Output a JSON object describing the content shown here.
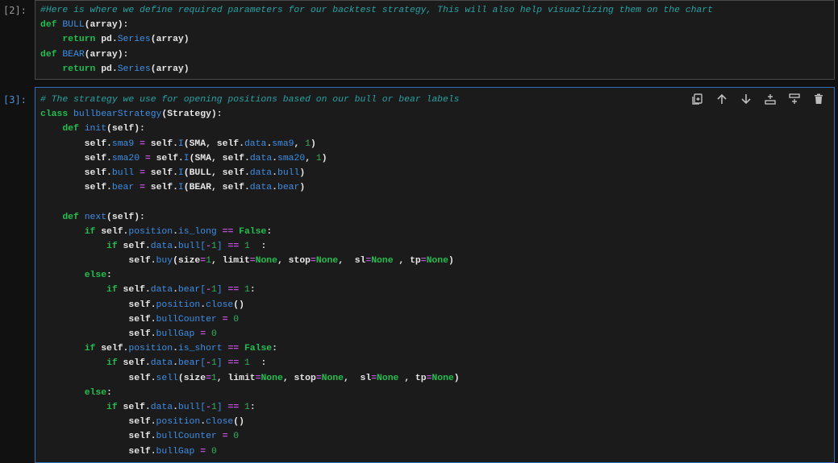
{
  "cells": [
    {
      "prompt": "[2]:",
      "active": false,
      "lines": [
        [
          {
            "t": "comment",
            "v": "#Here is where we define required parameters for our backtest strategy, This will also help visuazlizing them on the chart"
          }
        ],
        [
          {
            "t": "kw",
            "v": "def "
          },
          {
            "t": "def",
            "v": "BULL"
          },
          {
            "t": "plain",
            "v": "(array):"
          }
        ],
        [
          {
            "t": "plain",
            "v": "    "
          },
          {
            "t": "kw",
            "v": "return "
          },
          {
            "t": "plain",
            "v": "pd."
          },
          {
            "t": "attr",
            "v": "Series"
          },
          {
            "t": "plain",
            "v": "(array)"
          }
        ],
        [
          {
            "t": "kw",
            "v": "def "
          },
          {
            "t": "def",
            "v": "BEAR"
          },
          {
            "t": "plain",
            "v": "(array):"
          }
        ],
        [
          {
            "t": "plain",
            "v": "    "
          },
          {
            "t": "kw",
            "v": "return "
          },
          {
            "t": "plain",
            "v": "pd."
          },
          {
            "t": "attr",
            "v": "Series"
          },
          {
            "t": "plain",
            "v": "(array)"
          }
        ]
      ]
    },
    {
      "prompt": "[3]:",
      "active": true,
      "lines": [
        [
          {
            "t": "comment",
            "v": "# The strategy we use for opening positions based on our bull or bear labels"
          }
        ],
        [
          {
            "t": "kw",
            "v": "class "
          },
          {
            "t": "def",
            "v": "bullbearStrategy"
          },
          {
            "t": "plain",
            "v": "(Strategy):"
          }
        ],
        [
          {
            "t": "plain",
            "v": "    "
          },
          {
            "t": "kw",
            "v": "def "
          },
          {
            "t": "def",
            "v": "init"
          },
          {
            "t": "plain",
            "v": "(self):"
          }
        ],
        [
          {
            "t": "plain",
            "v": "        self."
          },
          {
            "t": "attr",
            "v": "sma9"
          },
          {
            "t": "plain",
            "v": " "
          },
          {
            "t": "op",
            "v": "="
          },
          {
            "t": "plain",
            "v": " self."
          },
          {
            "t": "attr",
            "v": "I"
          },
          {
            "t": "plain",
            "v": "(SMA, self."
          },
          {
            "t": "attr",
            "v": "data"
          },
          {
            "t": "plain",
            "v": "."
          },
          {
            "t": "attr",
            "v": "sma9"
          },
          {
            "t": "plain",
            "v": ", "
          },
          {
            "t": "num",
            "v": "1"
          },
          {
            "t": "plain",
            "v": ")"
          }
        ],
        [
          {
            "t": "plain",
            "v": "        self."
          },
          {
            "t": "attr",
            "v": "sma20"
          },
          {
            "t": "plain",
            "v": " "
          },
          {
            "t": "op",
            "v": "="
          },
          {
            "t": "plain",
            "v": " self."
          },
          {
            "t": "attr",
            "v": "I"
          },
          {
            "t": "plain",
            "v": "(SMA, self."
          },
          {
            "t": "attr",
            "v": "data"
          },
          {
            "t": "plain",
            "v": "."
          },
          {
            "t": "attr",
            "v": "sma20"
          },
          {
            "t": "plain",
            "v": ", "
          },
          {
            "t": "num",
            "v": "1"
          },
          {
            "t": "plain",
            "v": ")"
          }
        ],
        [
          {
            "t": "plain",
            "v": "        self."
          },
          {
            "t": "attr",
            "v": "bull"
          },
          {
            "t": "plain",
            "v": " "
          },
          {
            "t": "op",
            "v": "="
          },
          {
            "t": "plain",
            "v": " self."
          },
          {
            "t": "attr",
            "v": "I"
          },
          {
            "t": "plain",
            "v": "(BULL, self."
          },
          {
            "t": "attr",
            "v": "data"
          },
          {
            "t": "plain",
            "v": "."
          },
          {
            "t": "attr",
            "v": "bull"
          },
          {
            "t": "plain",
            "v": ")"
          }
        ],
        [
          {
            "t": "plain",
            "v": "        self."
          },
          {
            "t": "attr",
            "v": "bear"
          },
          {
            "t": "plain",
            "v": " "
          },
          {
            "t": "op",
            "v": "="
          },
          {
            "t": "plain",
            "v": " self."
          },
          {
            "t": "attr",
            "v": "I"
          },
          {
            "t": "plain",
            "v": "(BEAR, self."
          },
          {
            "t": "attr",
            "v": "data"
          },
          {
            "t": "plain",
            "v": "."
          },
          {
            "t": "attr",
            "v": "bear"
          },
          {
            "t": "plain",
            "v": ")"
          }
        ],
        [
          {
            "t": "plain",
            "v": ""
          }
        ],
        [
          {
            "t": "plain",
            "v": "    "
          },
          {
            "t": "kw",
            "v": "def "
          },
          {
            "t": "def",
            "v": "next"
          },
          {
            "t": "plain",
            "v": "(self):"
          }
        ],
        [
          {
            "t": "plain",
            "v": "        "
          },
          {
            "t": "kw",
            "v": "if "
          },
          {
            "t": "plain",
            "v": "self."
          },
          {
            "t": "attr",
            "v": "position"
          },
          {
            "t": "plain",
            "v": "."
          },
          {
            "t": "attr",
            "v": "is_long"
          },
          {
            "t": "plain",
            "v": " "
          },
          {
            "t": "op",
            "v": "=="
          },
          {
            "t": "plain",
            "v": " "
          },
          {
            "t": "kw",
            "v": "False"
          },
          {
            "t": "plain",
            "v": ":"
          }
        ],
        [
          {
            "t": "plain",
            "v": "            "
          },
          {
            "t": "kw",
            "v": "if "
          },
          {
            "t": "plain",
            "v": "self."
          },
          {
            "t": "attr",
            "v": "data"
          },
          {
            "t": "plain",
            "v": "."
          },
          {
            "t": "attr",
            "v": "bull"
          },
          {
            "t": "attr",
            "v": "["
          },
          {
            "t": "op",
            "v": "-"
          },
          {
            "t": "num",
            "v": "1"
          },
          {
            "t": "attr",
            "v": "]"
          },
          {
            "t": "plain",
            "v": " "
          },
          {
            "t": "op",
            "v": "=="
          },
          {
            "t": "plain",
            "v": " "
          },
          {
            "t": "num",
            "v": "1"
          },
          {
            "t": "plain",
            "v": "  :"
          }
        ],
        [
          {
            "t": "plain",
            "v": "                self."
          },
          {
            "t": "attr",
            "v": "buy"
          },
          {
            "t": "plain",
            "v": "(size"
          },
          {
            "t": "op",
            "v": "="
          },
          {
            "t": "num",
            "v": "1"
          },
          {
            "t": "plain",
            "v": ", limit"
          },
          {
            "t": "op",
            "v": "="
          },
          {
            "t": "kw",
            "v": "None"
          },
          {
            "t": "plain",
            "v": ", stop"
          },
          {
            "t": "op",
            "v": "="
          },
          {
            "t": "kw",
            "v": "None"
          },
          {
            "t": "plain",
            "v": ",  sl"
          },
          {
            "t": "op",
            "v": "="
          },
          {
            "t": "kw",
            "v": "None"
          },
          {
            "t": "plain",
            "v": " , tp"
          },
          {
            "t": "op",
            "v": "="
          },
          {
            "t": "kw",
            "v": "None"
          },
          {
            "t": "plain",
            "v": ")"
          }
        ],
        [
          {
            "t": "plain",
            "v": "        "
          },
          {
            "t": "kw",
            "v": "else"
          },
          {
            "t": "plain",
            "v": ":"
          }
        ],
        [
          {
            "t": "plain",
            "v": "            "
          },
          {
            "t": "kw",
            "v": "if "
          },
          {
            "t": "plain",
            "v": "self."
          },
          {
            "t": "attr",
            "v": "data"
          },
          {
            "t": "plain",
            "v": "."
          },
          {
            "t": "attr",
            "v": "bear"
          },
          {
            "t": "attr",
            "v": "["
          },
          {
            "t": "op",
            "v": "-"
          },
          {
            "t": "num",
            "v": "1"
          },
          {
            "t": "attr",
            "v": "]"
          },
          {
            "t": "plain",
            "v": " "
          },
          {
            "t": "op",
            "v": "=="
          },
          {
            "t": "plain",
            "v": " "
          },
          {
            "t": "num",
            "v": "1"
          },
          {
            "t": "plain",
            "v": ":"
          }
        ],
        [
          {
            "t": "plain",
            "v": "                self."
          },
          {
            "t": "attr",
            "v": "position"
          },
          {
            "t": "plain",
            "v": "."
          },
          {
            "t": "attr",
            "v": "close"
          },
          {
            "t": "plain",
            "v": "()"
          }
        ],
        [
          {
            "t": "plain",
            "v": "                self."
          },
          {
            "t": "attr",
            "v": "bullCounter"
          },
          {
            "t": "plain",
            "v": " "
          },
          {
            "t": "op",
            "v": "="
          },
          {
            "t": "plain",
            "v": " "
          },
          {
            "t": "num",
            "v": "0"
          }
        ],
        [
          {
            "t": "plain",
            "v": "                self."
          },
          {
            "t": "attr",
            "v": "bullGap"
          },
          {
            "t": "plain",
            "v": " "
          },
          {
            "t": "op",
            "v": "="
          },
          {
            "t": "plain",
            "v": " "
          },
          {
            "t": "num",
            "v": "0"
          }
        ],
        [
          {
            "t": "plain",
            "v": "        "
          },
          {
            "t": "kw",
            "v": "if "
          },
          {
            "t": "plain",
            "v": "self."
          },
          {
            "t": "attr",
            "v": "position"
          },
          {
            "t": "plain",
            "v": "."
          },
          {
            "t": "attr",
            "v": "is_short"
          },
          {
            "t": "plain",
            "v": " "
          },
          {
            "t": "op",
            "v": "=="
          },
          {
            "t": "plain",
            "v": " "
          },
          {
            "t": "kw",
            "v": "False"
          },
          {
            "t": "plain",
            "v": ":"
          }
        ],
        [
          {
            "t": "plain",
            "v": "            "
          },
          {
            "t": "kw",
            "v": "if "
          },
          {
            "t": "plain",
            "v": "self."
          },
          {
            "t": "attr",
            "v": "data"
          },
          {
            "t": "plain",
            "v": "."
          },
          {
            "t": "attr",
            "v": "bear"
          },
          {
            "t": "attr",
            "v": "["
          },
          {
            "t": "op",
            "v": "-"
          },
          {
            "t": "num",
            "v": "1"
          },
          {
            "t": "attr",
            "v": "]"
          },
          {
            "t": "plain",
            "v": " "
          },
          {
            "t": "op",
            "v": "=="
          },
          {
            "t": "plain",
            "v": " "
          },
          {
            "t": "num",
            "v": "1"
          },
          {
            "t": "plain",
            "v": "  :"
          }
        ],
        [
          {
            "t": "plain",
            "v": "                self."
          },
          {
            "t": "attr",
            "v": "sell"
          },
          {
            "t": "plain",
            "v": "(size"
          },
          {
            "t": "op",
            "v": "="
          },
          {
            "t": "num",
            "v": "1"
          },
          {
            "t": "plain",
            "v": ", limit"
          },
          {
            "t": "op",
            "v": "="
          },
          {
            "t": "kw",
            "v": "None"
          },
          {
            "t": "plain",
            "v": ", stop"
          },
          {
            "t": "op",
            "v": "="
          },
          {
            "t": "kw",
            "v": "None"
          },
          {
            "t": "plain",
            "v": ",  sl"
          },
          {
            "t": "op",
            "v": "="
          },
          {
            "t": "kw",
            "v": "None"
          },
          {
            "t": "plain",
            "v": " , tp"
          },
          {
            "t": "op",
            "v": "="
          },
          {
            "t": "kw",
            "v": "None"
          },
          {
            "t": "plain",
            "v": ")"
          }
        ],
        [
          {
            "t": "plain",
            "v": "        "
          },
          {
            "t": "kw",
            "v": "else"
          },
          {
            "t": "plain",
            "v": ":"
          }
        ],
        [
          {
            "t": "plain",
            "v": "            "
          },
          {
            "t": "kw",
            "v": "if "
          },
          {
            "t": "plain",
            "v": "self."
          },
          {
            "t": "attr",
            "v": "data"
          },
          {
            "t": "plain",
            "v": "."
          },
          {
            "t": "attr",
            "v": "bull"
          },
          {
            "t": "attr",
            "v": "["
          },
          {
            "t": "op",
            "v": "-"
          },
          {
            "t": "num",
            "v": "1"
          },
          {
            "t": "attr",
            "v": "]"
          },
          {
            "t": "plain",
            "v": " "
          },
          {
            "t": "op",
            "v": "=="
          },
          {
            "t": "plain",
            "v": " "
          },
          {
            "t": "num",
            "v": "1"
          },
          {
            "t": "plain",
            "v": ":"
          }
        ],
        [
          {
            "t": "plain",
            "v": "                self."
          },
          {
            "t": "attr",
            "v": "position"
          },
          {
            "t": "plain",
            "v": "."
          },
          {
            "t": "attr",
            "v": "close"
          },
          {
            "t": "plain",
            "v": "()"
          }
        ],
        [
          {
            "t": "plain",
            "v": "                self."
          },
          {
            "t": "attr",
            "v": "bullCounter"
          },
          {
            "t": "plain",
            "v": " "
          },
          {
            "t": "op",
            "v": "="
          },
          {
            "t": "plain",
            "v": " "
          },
          {
            "t": "num",
            "v": "0"
          }
        ],
        [
          {
            "t": "plain",
            "v": "                self."
          },
          {
            "t": "attr",
            "v": "bullGap"
          },
          {
            "t": "plain",
            "v": " "
          },
          {
            "t": "op",
            "v": "="
          },
          {
            "t": "plain",
            "v": " "
          },
          {
            "t": "num",
            "v": "0"
          }
        ]
      ]
    }
  ],
  "toolbar": {
    "buttons": [
      {
        "icon": "duplicate-icon",
        "name": "duplicate-cell-button"
      },
      {
        "icon": "arrow-up-icon",
        "name": "move-up-button"
      },
      {
        "icon": "arrow-down-icon",
        "name": "move-down-button"
      },
      {
        "icon": "insert-above-icon",
        "name": "insert-cell-above-button"
      },
      {
        "icon": "insert-below-icon",
        "name": "insert-cell-below-button"
      },
      {
        "icon": "trash-icon",
        "name": "delete-cell-button"
      }
    ]
  },
  "colors": {
    "background": "#111111",
    "editor_bg": "#1b1b1b",
    "active_border": "#2f6fb8",
    "keyword": "#1fbf4f",
    "name": "#3d8fe6",
    "comment": "#24a3a3",
    "operator": "#b94fd0"
  }
}
